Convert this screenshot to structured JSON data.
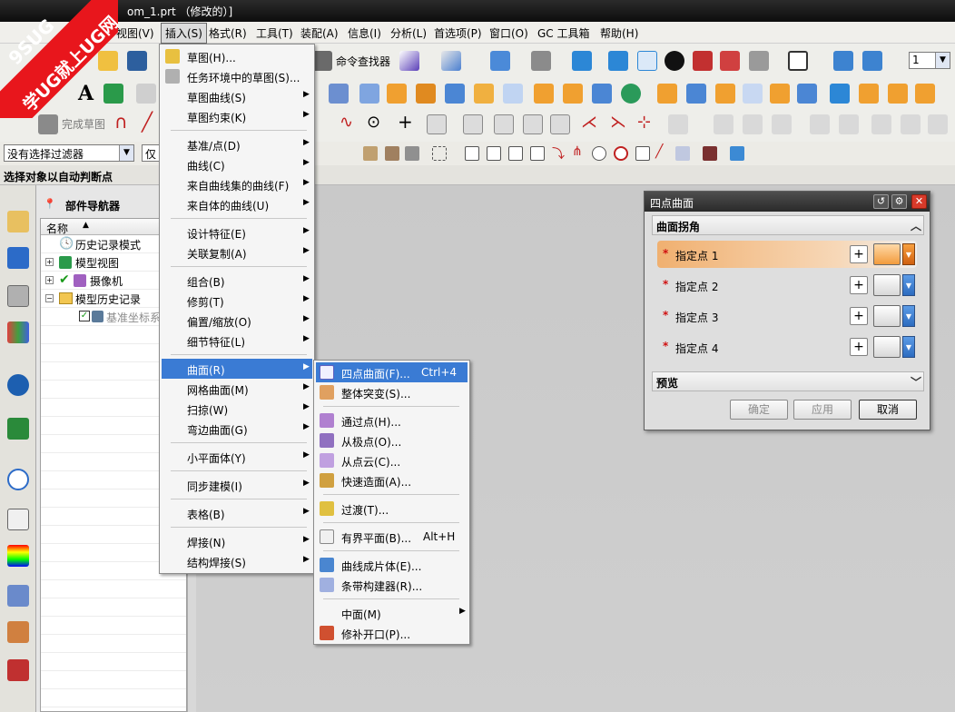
{
  "window": {
    "title": "om_1.prt （修改的）]"
  },
  "watermark": {
    "line1": "9SUG",
    "line2": "学UG就上UG网"
  },
  "menubar": {
    "items": [
      "视图(V)",
      "插入(S)",
      "格式(R)",
      "工具(T)",
      "装配(A)",
      "信息(I)",
      "分析(L)",
      "首选项(P)",
      "窗口(O)",
      "GC 工具箱",
      "帮助(H)"
    ]
  },
  "toolbar": {
    "command_finder": "命令查找器",
    "finish_sketch": "完成草图",
    "layer_value": "1"
  },
  "filter": {
    "selection_filter": "没有选择过滤器",
    "scope_prefix": "仅"
  },
  "status": {
    "prompt": "选择对象以自动判断点"
  },
  "navigator": {
    "title": "部件导航器",
    "column_name": "名称",
    "items": [
      "历史记录模式",
      "模型视图",
      "摄像机",
      "模型历史记录",
      "基准坐标系"
    ]
  },
  "insert_menu": {
    "items": [
      "草图(H)...",
      "任务环境中的草图(S)...",
      "草图曲线(S)",
      "草图约束(K)",
      "基准/点(D)",
      "曲线(C)",
      "来自曲线集的曲线(F)",
      "来自体的曲线(U)",
      "设计特征(E)",
      "关联复制(A)",
      "组合(B)",
      "修剪(T)",
      "偏置/缩放(O)",
      "细节特征(L)",
      "曲面(R)",
      "网格曲面(M)",
      "扫掠(W)",
      "弯边曲面(G)",
      "小平面体(Y)",
      "同步建模(I)",
      "表格(B)",
      "焊接(N)",
      "结构焊接(S)"
    ]
  },
  "surface_menu": {
    "items": [
      "四点曲面(F)...",
      "整体突变(S)...",
      "通过点(H)...",
      "从极点(O)...",
      "从点云(C)...",
      "快速造面(A)...",
      "过渡(T)...",
      "有界平面(B)...",
      "曲线成片体(E)...",
      "条带构建器(R)...",
      "中面(M)",
      "修补开口(P)..."
    ],
    "shortcuts": {
      "four_point": "Ctrl+4",
      "bounded_plane": "Alt+H"
    }
  },
  "dialog": {
    "title": "四点曲面",
    "group_label": "曲面拐角",
    "points": [
      "指定点 1",
      "指定点 2",
      "指定点 3",
      "指定点 4"
    ],
    "preview_label": "预览",
    "ok": "确定",
    "apply": "应用",
    "cancel": "取消"
  },
  "colors": {
    "menu_highlight": "#3a7bd4",
    "active_point": "#f0b070",
    "watermark": "#e8161c"
  }
}
